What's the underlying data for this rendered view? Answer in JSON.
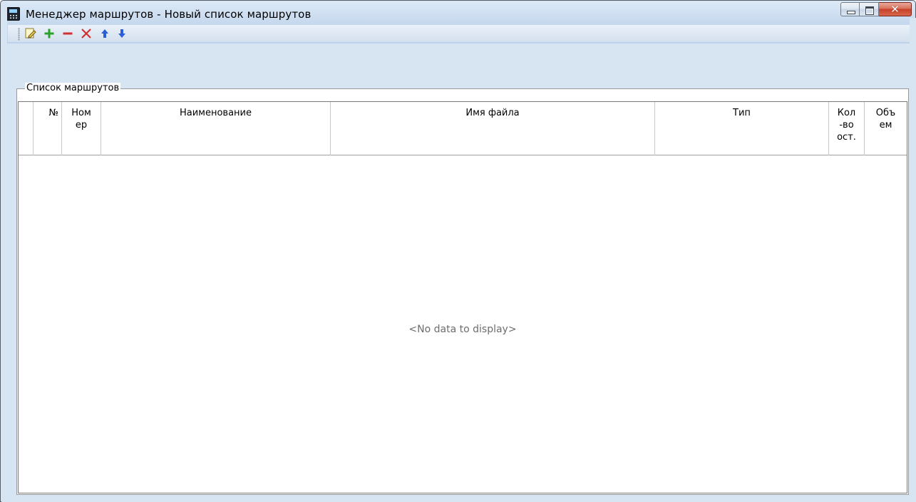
{
  "window": {
    "title": "Менеджер маршрутов - Новый список маршрутов",
    "icon": "calculator-icon",
    "close_glyph": "✕"
  },
  "toolbar": {
    "buttons": [
      {
        "name": "edit",
        "icon": "edit-icon"
      },
      {
        "name": "add",
        "icon": "plus-icon"
      },
      {
        "name": "remove",
        "icon": "minus-icon"
      },
      {
        "name": "delete",
        "icon": "cross-icon"
      },
      {
        "name": "move-up",
        "icon": "arrow-up-icon"
      },
      {
        "name": "move-down",
        "icon": "arrow-down-icon"
      }
    ]
  },
  "routes_group": {
    "label": "Список маршрутов",
    "columns": {
      "num": "№",
      "nomer": "Номер",
      "name": "Наименование",
      "file": "Имя файла",
      "type": "Тип",
      "stops": "Кол-во ост.",
      "volume": "Объем"
    },
    "empty_text": "<No data to display>"
  },
  "colors": {
    "frame": "#d7e4f2",
    "add_green": "#2aa12a",
    "remove_red": "#d13131",
    "arrow_blue": "#2a5fd6"
  }
}
